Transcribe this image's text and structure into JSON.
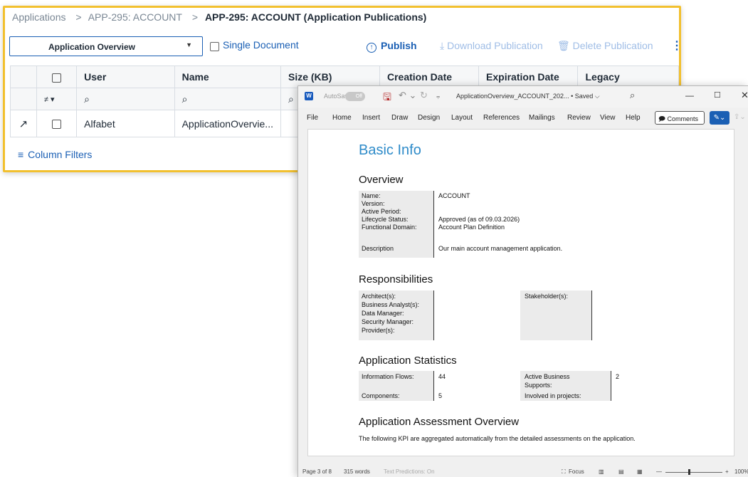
{
  "breadcrumb": {
    "item1": "Applications",
    "item2": "APP-295: ACCOUNT",
    "current": "APP-295: ACCOUNT (Application Publications)"
  },
  "toolbar": {
    "select_value": "Application Overview",
    "single_document_label": "Single Document",
    "publish_label": "Publish",
    "download_label": "Download Publication",
    "delete_label": "Delete Publication"
  },
  "grid": {
    "headers": [
      "User",
      "Name",
      "Size (KB)",
      "Creation Date",
      "Expiration Date",
      "Legacy"
    ],
    "row": {
      "user": "Alfabet",
      "name": "ApplicationOvervie..."
    },
    "column_filters_label": "Column Filters"
  },
  "word": {
    "autosave_label": "AutoSave",
    "autosave_toggle": "Off",
    "doc_title": "ApplicationOverview_ACCOUNT_202...  • Saved ⌵",
    "menu": [
      "File",
      "Home",
      "Insert",
      "Draw",
      "Design",
      "Layout",
      "References",
      "Mailings",
      "Review",
      "View",
      "Help"
    ],
    "comments_label": "Comments",
    "page": {
      "h_basic": "Basic Info",
      "h_overview": "Overview",
      "ov_labels": [
        "Name:",
        "Version:",
        "Active Period:",
        "Lifecycle Status:",
        "Functional Domain:"
      ],
      "ov_values": [
        "ACCOUNT",
        "",
        "",
        "Approved (as of 09.03.2026)",
        "Account Plan Definition"
      ],
      "desc_label": "Description",
      "desc_value": "Our main account management application.",
      "h_resp": "Responsibilities",
      "resp_labels": [
        "Architect(s):",
        "Business Analyst(s):",
        "Data Manager:",
        "Security Manager:",
        "Provider(s):"
      ],
      "stakeholder_label": "Stakeholder(s):",
      "h_stats": "Application Statistics",
      "info_flows_label": "Information Flows:",
      "info_flows_value": "44",
      "components_label": "Components:",
      "components_value": "5",
      "active_bs_label_1": "Active Business",
      "active_bs_label_2": "Supports:",
      "active_bs_value": "2",
      "involved_label": "Involved in projects:",
      "h_assess": "Application Assessment Overview",
      "assess_text": "The following KPI are aggregated automatically from the detailed assessments on the application."
    },
    "status": {
      "page": "Page 3 of 8",
      "words": "315 words",
      "predictions": "Text Predictions: On",
      "focus": "Focus",
      "zoom": "100%"
    }
  }
}
